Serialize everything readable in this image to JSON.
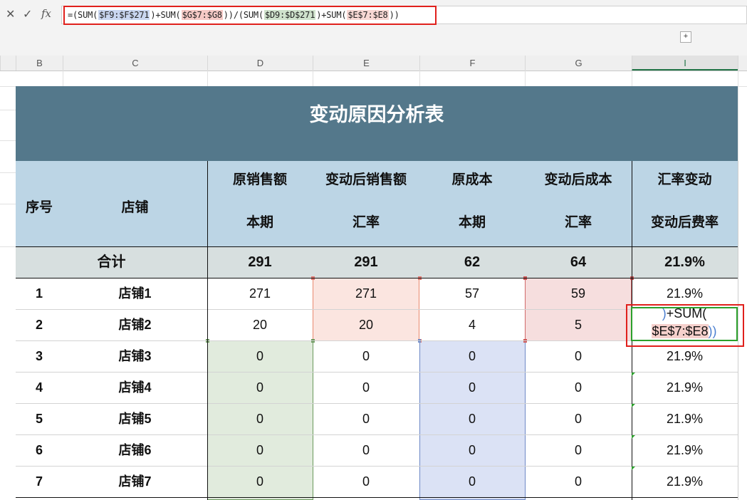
{
  "formula_bar": {
    "cancel_icon": "✕",
    "confirm_icon": "✓",
    "fx_label": "fx",
    "formula": {
      "p1": "=(SUM(",
      "r1": "$F9:$F$271",
      "p2": ")+SUM(",
      "r2": "$G$7:$G8",
      "p3": "))/(SUM(",
      "r3": "$D9:$D$271",
      "p4": ")+SUM(",
      "r4": "$E$7:$E8",
      "p5": "))"
    },
    "expand_icon": "+"
  },
  "column_headers": [
    "B",
    "C",
    "D",
    "E",
    "F",
    "G",
    "I"
  ],
  "sheet": {
    "title": "变动原因分析表",
    "headers": {
      "seq": "序号",
      "store": "店铺",
      "d_top": "原销售额",
      "d_bottom": "本期",
      "e_top": "变动后销售额",
      "e_bottom": "汇率",
      "f_top": "原成本",
      "f_bottom": "本期",
      "g_top": "变动后成本",
      "g_bottom": "汇率",
      "i_top": "汇率变动",
      "i_bottom": "变动后费率"
    },
    "total": {
      "label": "合计",
      "d": "291",
      "e": "291",
      "f": "62",
      "g": "64",
      "i": "21.9%"
    },
    "rows": [
      {
        "seq": "1",
        "store": "店铺1",
        "d": "271",
        "e": "271",
        "f": "57",
        "g": "59",
        "i": "21.9%"
      },
      {
        "seq": "2",
        "store": "店铺2",
        "d": "20",
        "e": "20",
        "f": "4",
        "g": "5",
        "i": ""
      },
      {
        "seq": "3",
        "store": "店铺3",
        "d": "0",
        "e": "0",
        "f": "0",
        "g": "0",
        "i": "21.9%"
      },
      {
        "seq": "4",
        "store": "店铺4",
        "d": "0",
        "e": "0",
        "f": "0",
        "g": "0",
        "i": "21.9%"
      },
      {
        "seq": "5",
        "store": "店铺5",
        "d": "0",
        "e": "0",
        "f": "0",
        "g": "0",
        "i": "21.9%"
      },
      {
        "seq": "6",
        "store": "店铺6",
        "d": "0",
        "e": "0",
        "f": "0",
        "g": "0",
        "i": "21.9%"
      },
      {
        "seq": "7",
        "store": "店铺7",
        "d": "0",
        "e": "0",
        "f": "0",
        "g": "0",
        "i": "21.9%"
      }
    ],
    "editor": {
      "line1_paren": ")",
      "line1_text": "+SUM(",
      "line2_ref": "$E$7:$E8",
      "line2_close": "))"
    }
  },
  "colors": {
    "title_band": "#54788b",
    "header_band": "#bcd5e5",
    "total_band": "#d7dfdf",
    "highlight_red": "#e0201c",
    "active_green": "#217346"
  }
}
